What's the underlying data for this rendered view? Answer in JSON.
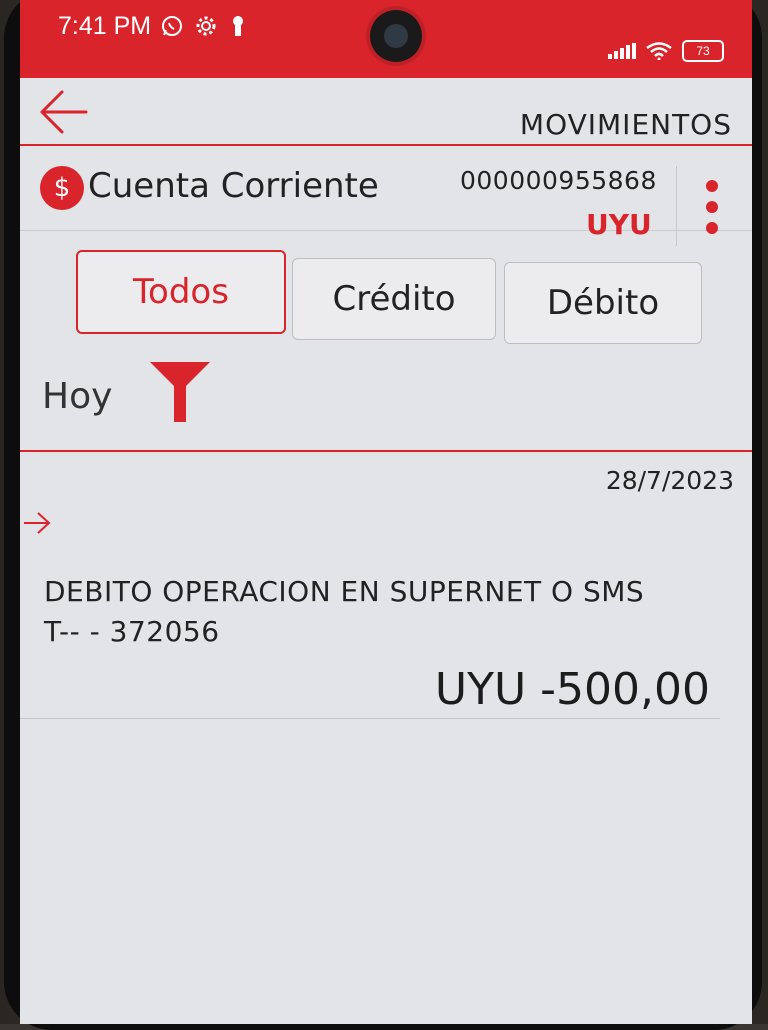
{
  "status_bar": {
    "time": "7:41 PM",
    "battery": "73",
    "icons_left": [
      "whatsapp-icon",
      "gear-icon",
      "lock-icon"
    ],
    "icons_right": [
      "signal-icon",
      "wifi-icon",
      "battery-icon"
    ]
  },
  "header": {
    "title": "MOVIMIENTOS",
    "back_icon": "back-arrow-icon"
  },
  "account": {
    "icon_glyph": "$",
    "name": "Cuenta Corriente",
    "number": "000000955868",
    "currency": "UYU"
  },
  "tabs": [
    {
      "label": "Todos",
      "active": true
    },
    {
      "label": "Crédito",
      "active": false
    },
    {
      "label": "Débito",
      "active": false
    }
  ],
  "period": {
    "label": "Hoy"
  },
  "movement": {
    "date": "28/7/2023",
    "description_line1": "DEBITO OPERACION EN SUPERNET O SMS",
    "description_line2": "T-- - 372056",
    "amount": "UYU -500,00"
  },
  "colors": {
    "brand_red": "#d9242b",
    "screen_bg": "#e3e4e8",
    "text": "#222222"
  }
}
